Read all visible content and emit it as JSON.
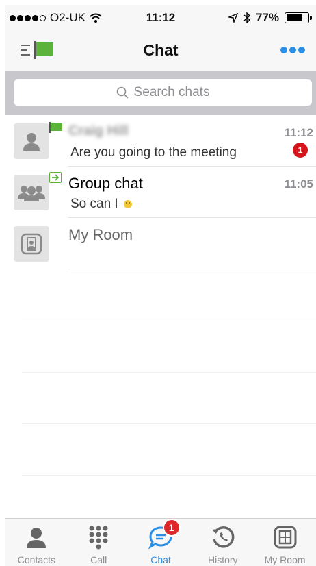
{
  "status_bar": {
    "carrier": "O2-UK",
    "time": "11:12",
    "battery": "77%",
    "battery_level": 0.77
  },
  "header": {
    "title": "Chat"
  },
  "search": {
    "placeholder": "Search chats"
  },
  "chats": [
    {
      "name": "Craig Hill",
      "message": "Are you going to the meeting",
      "time": "11:12",
      "unread": "1"
    },
    {
      "name": "Group chat",
      "message": "So can I",
      "time": "11:05"
    },
    {
      "name": "My Room"
    }
  ],
  "tabbar": {
    "tabs": [
      {
        "label": "Contacts"
      },
      {
        "label": "Call"
      },
      {
        "label": "Chat",
        "badge": "1"
      },
      {
        "label": "History"
      },
      {
        "label": "My Room"
      }
    ]
  },
  "colors": {
    "accent": "#2a8fe6",
    "flag": "#5bb33b",
    "badge": "#d4151c"
  }
}
